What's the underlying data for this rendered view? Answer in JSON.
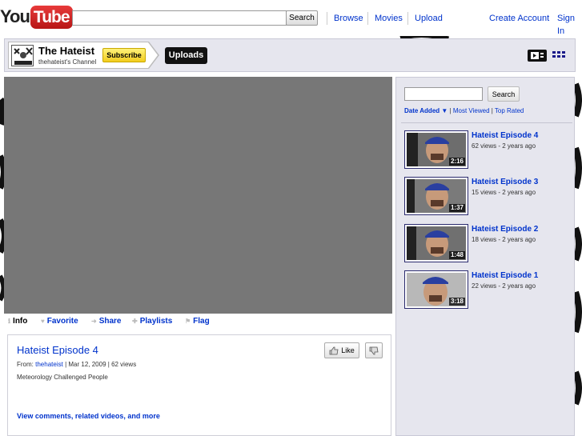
{
  "masthead": {
    "logo_you": "You",
    "logo_tube": "Tube",
    "search_placeholder": "",
    "search_label": "Search",
    "nav": [
      "Browse",
      "Movies",
      "Upload"
    ],
    "create_account": "Create Account",
    "sign_in": "Sign In"
  },
  "channel": {
    "title": "The Hateist",
    "subtitle": "thehateist's Channel",
    "subscribe_label": "Subscribe",
    "uploads_tab": "Uploads",
    "avatar_icon": "channel-avatar"
  },
  "player_tabs": {
    "info": "Info",
    "favorite": "Favorite",
    "share": "Share",
    "playlists": "Playlists",
    "flag": "Flag"
  },
  "video": {
    "title": "Hateist Episode 4",
    "from_label": "From:",
    "author": "thehateist",
    "date": "Mar 12, 2009",
    "views": "62 views",
    "description": "Meteorology Challenged People",
    "like_label": "Like",
    "view_more": "View comments, related videos, and more"
  },
  "sidebar": {
    "search_label": "Search",
    "sort": {
      "date_added": "Date Added",
      "most_viewed": "Most Viewed",
      "top_rated": "Top Rated"
    },
    "videos": [
      {
        "title": "Hateist Episode 4",
        "meta": "62 views - 2 years ago",
        "duration": "2:16"
      },
      {
        "title": "Hateist Episode 3",
        "meta": "15 views - 2 years ago",
        "duration": "1:37"
      },
      {
        "title": "Hateist Episode 2",
        "meta": "18 views - 2 years ago",
        "duration": "1:48"
      },
      {
        "title": "Hateist Episode 1",
        "meta": "22 views - 2 years ago",
        "duration": "3:18"
      }
    ]
  },
  "colors": {
    "link": "#0033cc",
    "logo_red": "#d32222",
    "panel": "#e6e6ee",
    "player": "#777777",
    "subscribe": "#f2cc1e"
  }
}
